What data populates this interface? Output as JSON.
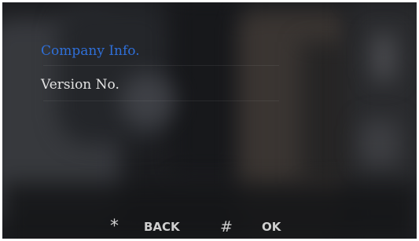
{
  "menu": {
    "items": [
      {
        "label": "Company Info.",
        "selected": true
      },
      {
        "label": "Version No.",
        "selected": false
      }
    ]
  },
  "footer": {
    "back": {
      "key": "*",
      "label": "BACK"
    },
    "ok": {
      "key": "#",
      "label": "OK"
    }
  },
  "colors": {
    "selected_text": "#2f6fd8",
    "normal_text": "#e4e4e4",
    "footer_text": "#cfcfcf",
    "background": "#1c1d20"
  }
}
